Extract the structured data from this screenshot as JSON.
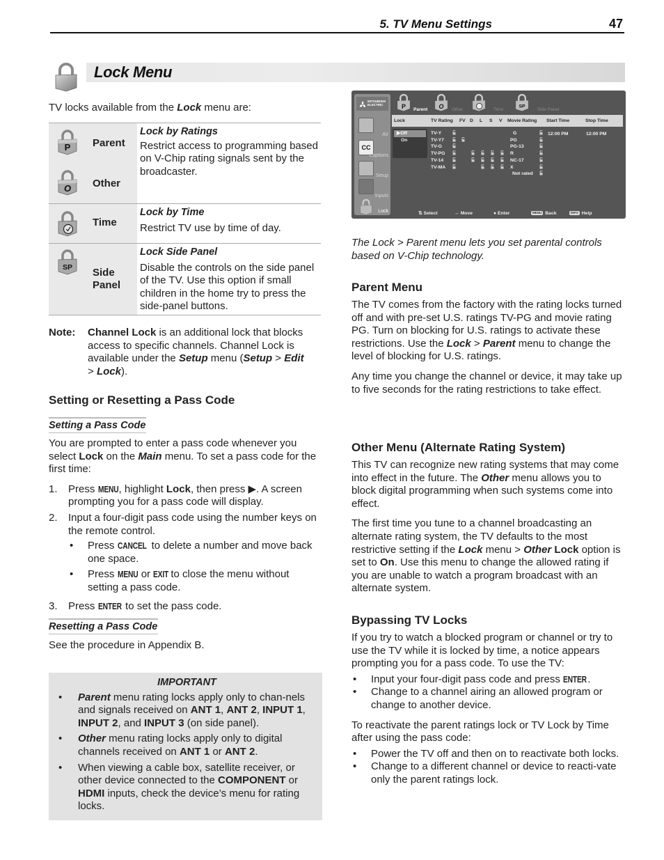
{
  "running_header": {
    "section": "5.  TV Menu Settings",
    "page_number": "47"
  },
  "title": "Lock Menu",
  "intro": [
    "TV locks available from the ",
    "Lock",
    " menu are:"
  ],
  "lock_table": [
    {
      "items": [
        {
          "icon": "parent-lock-icon",
          "glyph": "P",
          "name": "Parent"
        },
        {
          "icon": "other-lock-icon",
          "glyph": "O",
          "name": "Other"
        }
      ],
      "title": "Lock by Ratings",
      "description": "Restrict access to programming based on V-Chip rating signals sent by the broadcaster."
    },
    {
      "items": [
        {
          "icon": "time-lock-icon",
          "glyph": "clock",
          "name": "Time"
        }
      ],
      "title": "Lock by Time",
      "description": "Restrict TV use by time of day."
    },
    {
      "items": [
        {
          "icon": "side-panel-lock-icon",
          "glyph": "SP",
          "name": "Side Panel"
        }
      ],
      "title": "Lock Side Panel",
      "description": "Disable the controls on the side panel of the TV.  Use this option if small children in the home try to press the side-panel buttons."
    }
  ],
  "note": {
    "label": "Note:",
    "parts": [
      "Channel Lock",
      " is an additional lock that blocks access to specific channels.  Channel Lock is available under the ",
      "Setup",
      " menu (",
      "Setup",
      " > ",
      "Edit",
      " > ",
      "Lock",
      ")."
    ]
  },
  "pass_code": {
    "heading": "Setting or Resetting a Pass Code",
    "setting_heading": "Setting a Pass Code",
    "setting_intro": [
      "You are prompted to enter a pass code whenever you select ",
      "Lock",
      " on the ",
      "Main",
      " menu.  To set a pass code for the first time:"
    ],
    "steps": [
      {
        "num": "1.",
        "parts": [
          "Press ",
          "MENU",
          ", highlight ",
          "Lock",
          ", then press ",
          "▶",
          ".  A screen prompting you for a pass code will display."
        ]
      },
      {
        "num": "2.",
        "text": "Input a four-digit pass code using the number keys on the remote control.",
        "bullets": [
          {
            "parts": [
              "Press ",
              "CANCEL",
              " to delete a number and move back one space."
            ]
          },
          {
            "parts": [
              "Press ",
              "MENU",
              " or ",
              "EXIT",
              " to close the menu without setting a pass code."
            ]
          }
        ]
      },
      {
        "num": "3.",
        "parts": [
          "Press ",
          "ENTER",
          " to set the pass code."
        ]
      }
    ],
    "resetting_heading": "Resetting a Pass Code",
    "resetting_text": "See the procedure in Appendix B."
  },
  "important": {
    "heading": "IMPORTANT",
    "items": [
      {
        "parts": [
          "Parent",
          " menu rating locks apply only to chan-nels and signals received on ",
          "ANT 1",
          ", ",
          "ANT 2",
          ", ",
          "INPUT 1",
          ", ",
          "INPUT 2",
          ", and ",
          "INPUT 3",
          " (on side panel)."
        ]
      },
      {
        "parts": [
          "Other",
          " menu rating locks apply only to digital channels received on ",
          "ANT 1",
          " or ",
          "ANT 2",
          "."
        ]
      },
      {
        "parts": [
          "When viewing a cable box, satellite receiver, or other device connected to the ",
          "COMPONENT",
          " or ",
          "HDMI",
          " inputs, check the device’s menu for rating locks."
        ]
      }
    ]
  },
  "tv_screen": {
    "brand": [
      "MITSUBISHI",
      "ELECTRIC"
    ],
    "sidebar": [
      "AV",
      "Captions",
      "Setup",
      "Inputs",
      "Lock"
    ],
    "tabs": [
      {
        "glyph": "P",
        "label": "Parent",
        "active": true
      },
      {
        "glyph": "O",
        "label": "Other",
        "active": false
      },
      {
        "glyph": "✓",
        "label": "Time",
        "active": false
      },
      {
        "glyph": "SP",
        "label": "Side Panel",
        "active": false
      }
    ],
    "columns": [
      "Lock",
      "TV Rating",
      "FV",
      "D",
      "L",
      "S",
      "V",
      "Movie Rating",
      "Start Time",
      "Stop Time"
    ],
    "lock_options": [
      {
        "label": "Off",
        "selected": true,
        "marker": "▶"
      },
      {
        "label": "On",
        "selected": false
      }
    ],
    "tv_ratings": [
      "TV-Y",
      "TV-Y7",
      "TV-G",
      "TV-PG",
      "TV-14",
      "TV-MA"
    ],
    "movie_ratings": [
      "G",
      "PG",
      "PG-13",
      "R",
      "NC-17",
      "X",
      "Not rated"
    ],
    "start_time": "12:00 PM",
    "stop_time": "12:00 PM",
    "footer": [
      {
        "key": "⇅",
        "label": "Select"
      },
      {
        "key": "↔",
        "label": "Move"
      },
      {
        "key": "●",
        "label": "Enter"
      },
      {
        "key": "MENU",
        "label": "Back"
      },
      {
        "key": "INFO",
        "label": "Help"
      }
    ]
  },
  "tv_caption": "The Lock > Parent menu lets you set parental controls based on V-Chip technology.",
  "parent_menu": {
    "heading": "Parent Menu",
    "p1": [
      "The TV comes from the factory with the rating locks turned off and with pre-set U.S. ratings TV-PG and movie rating PG.  Turn on blocking for U.S. ratings to activate these restrictions.  Use the ",
      "Lock",
      " > ",
      "Parent",
      " menu to change the level of blocking for U.S. ratings."
    ],
    "p2": "Any time you change the channel or device, it may take up to five seconds for the rating restrictions to take effect."
  },
  "other_menu": {
    "heading": "Other Menu (Alternate Rating System)",
    "p1": [
      "This TV can recognize new rating systems that may come into effect in the future.  The ",
      "Other",
      " menu allows you to block digital programming when such systems come into effect."
    ],
    "p2": [
      "The first time you tune to a channel broadcasting an alternate rating system, the TV defaults to the most restrictive setting if the ",
      "Lock",
      " menu > ",
      "Other",
      " ",
      "Lock",
      " option is set to ",
      "On",
      ".  Use this menu to change the allowed rating if you are unable to watch a program broadcast with an alternate system."
    ]
  },
  "bypassing": {
    "heading": "Bypassing TV Locks",
    "p1": "If you try to watch a blocked program or channel or try to use the TV while it is locked by time, a notice appears prompting you for a pass code.  To use the TV:",
    "bullets1": [
      {
        "parts": [
          "Input your four-digit pass code and press ",
          "ENTER",
          "."
        ]
      },
      {
        "parts": [
          "Change to a channel airing an allowed program or change to another device."
        ]
      }
    ],
    "p2": "To reactivate the parent ratings lock or TV Lock by Time after using the pass code:",
    "bullets2": [
      "Power the TV off and then on to reactivate both locks.",
      "Change to a different channel or device to reacti-vate only the parent ratings lock."
    ]
  }
}
